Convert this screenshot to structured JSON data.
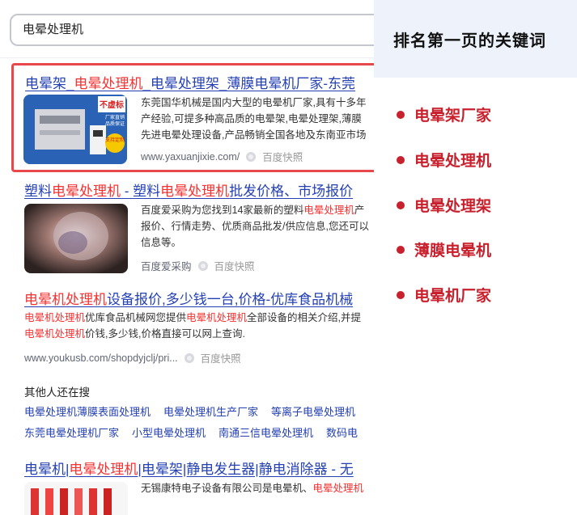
{
  "search": {
    "query": "电晕处理机"
  },
  "results": [
    {
      "title_parts": [
        {
          "text": "电晕架_",
          "hl": false
        },
        {
          "text": "电晕处理机",
          "hl": true
        },
        {
          "text": "_电晕处理架_薄膜电晕机厂家-东莞",
          "hl": false
        }
      ],
      "desc_lines": [
        [
          {
            "text": "东莞国华机械是国内大型的电晕机厂家,具有十多年",
            "hl": false
          }
        ],
        [
          {
            "text": "产经验,可提多种高品质的电晕架,电晕处理架,薄膜",
            "hl": false
          }
        ],
        [
          {
            "text": "先进电晕处理设备,产品畅销全国各地及东南亚市场",
            "hl": false
          }
        ]
      ],
      "url": "www.yaxuanjixie.com/",
      "snapshot": "百度快照"
    },
    {
      "title_parts": [
        {
          "text": "塑料",
          "hl": false
        },
        {
          "text": "电晕处理机",
          "hl": true
        },
        {
          "text": " - 塑料",
          "hl": false
        },
        {
          "text": "电晕处理机",
          "hl": true
        },
        {
          "text": "批发价格、市场报价",
          "hl": false
        }
      ],
      "desc_lines": [
        [
          {
            "text": "百度爱采购为您找到14家最新的塑料",
            "hl": false
          },
          {
            "text": "电晕处理机",
            "hl": true
          },
          {
            "text": "产",
            "hl": false
          }
        ],
        [
          {
            "text": "报价、行情走势、优质商品批发/供应信息,您还可以",
            "hl": false
          }
        ],
        [
          {
            "text": "信息等。",
            "hl": false
          }
        ]
      ],
      "source": "百度爱采购",
      "snapshot": "百度快照"
    },
    {
      "title_parts": [
        {
          "text": "电晕机处理机",
          "hl": true
        },
        {
          "text": "设备报价,多少钱一台,价格-优库食品机械",
          "hl": false
        }
      ],
      "desc_lines": [
        [
          {
            "text": "电晕机处理机",
            "hl": true
          },
          {
            "text": "优库食品机械网您提供",
            "hl": false
          },
          {
            "text": "电晕机处理机",
            "hl": true
          },
          {
            "text": "全部设备的相关介绍,并提",
            "hl": false
          }
        ],
        [
          {
            "text": "电晕机处理机",
            "hl": true
          },
          {
            "text": "价钱,多少钱,价格直接可以网上查询.",
            "hl": false
          }
        ]
      ],
      "url": "www.youkusb.com/shopdyjclj/pri...",
      "snapshot": "百度快照"
    },
    {
      "title_parts": [
        {
          "text": "电晕机|",
          "hl": false
        },
        {
          "text": "电晕处理机",
          "hl": true
        },
        {
          "text": "|电晕架|静电发生器|静电消除器 - 无",
          "hl": false
        }
      ],
      "desc_lines": [
        [
          {
            "text": "无锡康特电子设备有限公司是电晕机、",
            "hl": false
          },
          {
            "text": "电晕处理机",
            "hl": true
          }
        ]
      ]
    }
  ],
  "related": {
    "title": "其他人还在搜",
    "row1": [
      "电晕处理机薄膜表面处理机",
      "电晕处理机生产厂家",
      "等离子电晕处理机"
    ],
    "row2": [
      "东莞电晕处理机厂家",
      "小型电晕处理机",
      "南通三信电晕处理机",
      "数码电"
    ]
  },
  "thumb1_badges": [
    "不虚标",
    "厂家直销",
    "品质保证",
    "支持定制"
  ],
  "panel": {
    "title": "排名第一页的关键词",
    "keywords": [
      "电晕架厂家",
      "电晕处理机",
      "电晕处理架",
      "薄膜电晕机",
      "电晕机厂家"
    ]
  },
  "colors": {
    "accent_red": "#c8202c",
    "link_blue": "#2440b3",
    "highlight": "#f73131",
    "panel_bg": "#eef3fb"
  }
}
